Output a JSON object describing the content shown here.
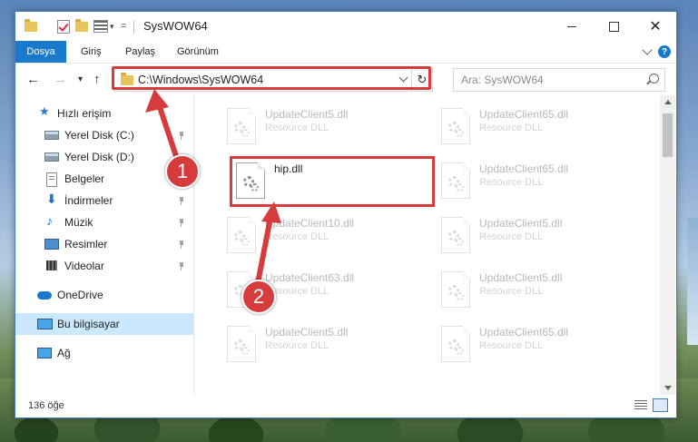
{
  "window": {
    "title": "SysWOW64"
  },
  "ribbon": {
    "tabs": [
      "Dosya",
      "Giriş",
      "Paylaş",
      "Görünüm"
    ]
  },
  "address": {
    "path": "C:\\Windows\\SysWOW64"
  },
  "search": {
    "placeholder": "Ara: SysWOW64"
  },
  "nav": {
    "items": [
      {
        "label": "Hızlı erişim",
        "icon": "star-icon"
      },
      {
        "label": "Yerel Disk (C:)",
        "icon": "drive-icon",
        "pinned": true
      },
      {
        "label": "Yerel Disk (D:)",
        "icon": "drive-icon"
      },
      {
        "label": "Belgeler",
        "icon": "document-icon",
        "pinned": true
      },
      {
        "label": "İndirmeler",
        "icon": "download-icon",
        "pinned": true
      },
      {
        "label": "Müzik",
        "icon": "music-icon",
        "pinned": true
      },
      {
        "label": "Resimler",
        "icon": "pictures-icon",
        "pinned": true
      },
      {
        "label": "Videolar",
        "icon": "videos-icon",
        "pinned": true
      },
      {
        "label": "OneDrive",
        "icon": "cloud-icon"
      },
      {
        "label": "Bu bilgisayar",
        "icon": "computer-icon",
        "selected": true
      },
      {
        "label": "Ağ",
        "icon": "network-icon"
      }
    ]
  },
  "files": [
    {
      "name": "UpdateClient5.dll",
      "type": "Resource DLL"
    },
    {
      "name": "UpdateClient65.dll",
      "type": "Resource DLL"
    },
    {
      "name": "hip.dll",
      "type": ""
    },
    {
      "name": "UpdateClient65.dll",
      "type": "Resource DLL"
    },
    {
      "name": "UpdateClient10.dll",
      "type": "Resource DLL"
    },
    {
      "name": "UpdateClient5.dll",
      "type": "Resource DLL"
    },
    {
      "name": "UpdateClient63.dll",
      "type": "Resource DLL"
    },
    {
      "name": "UpdateClient5.dll",
      "type": "Resource DLL"
    },
    {
      "name": "UpdateClient5.dll",
      "type": "Resource DLL"
    },
    {
      "name": "UpdateClient65.dll",
      "type": "Resource DLL"
    }
  ],
  "status": {
    "count": "136 öğe"
  },
  "callouts": [
    "1",
    "2"
  ],
  "colors": {
    "accent": "#1979ca",
    "highlight": "#d63c3c",
    "selected": "#cce8ff"
  }
}
